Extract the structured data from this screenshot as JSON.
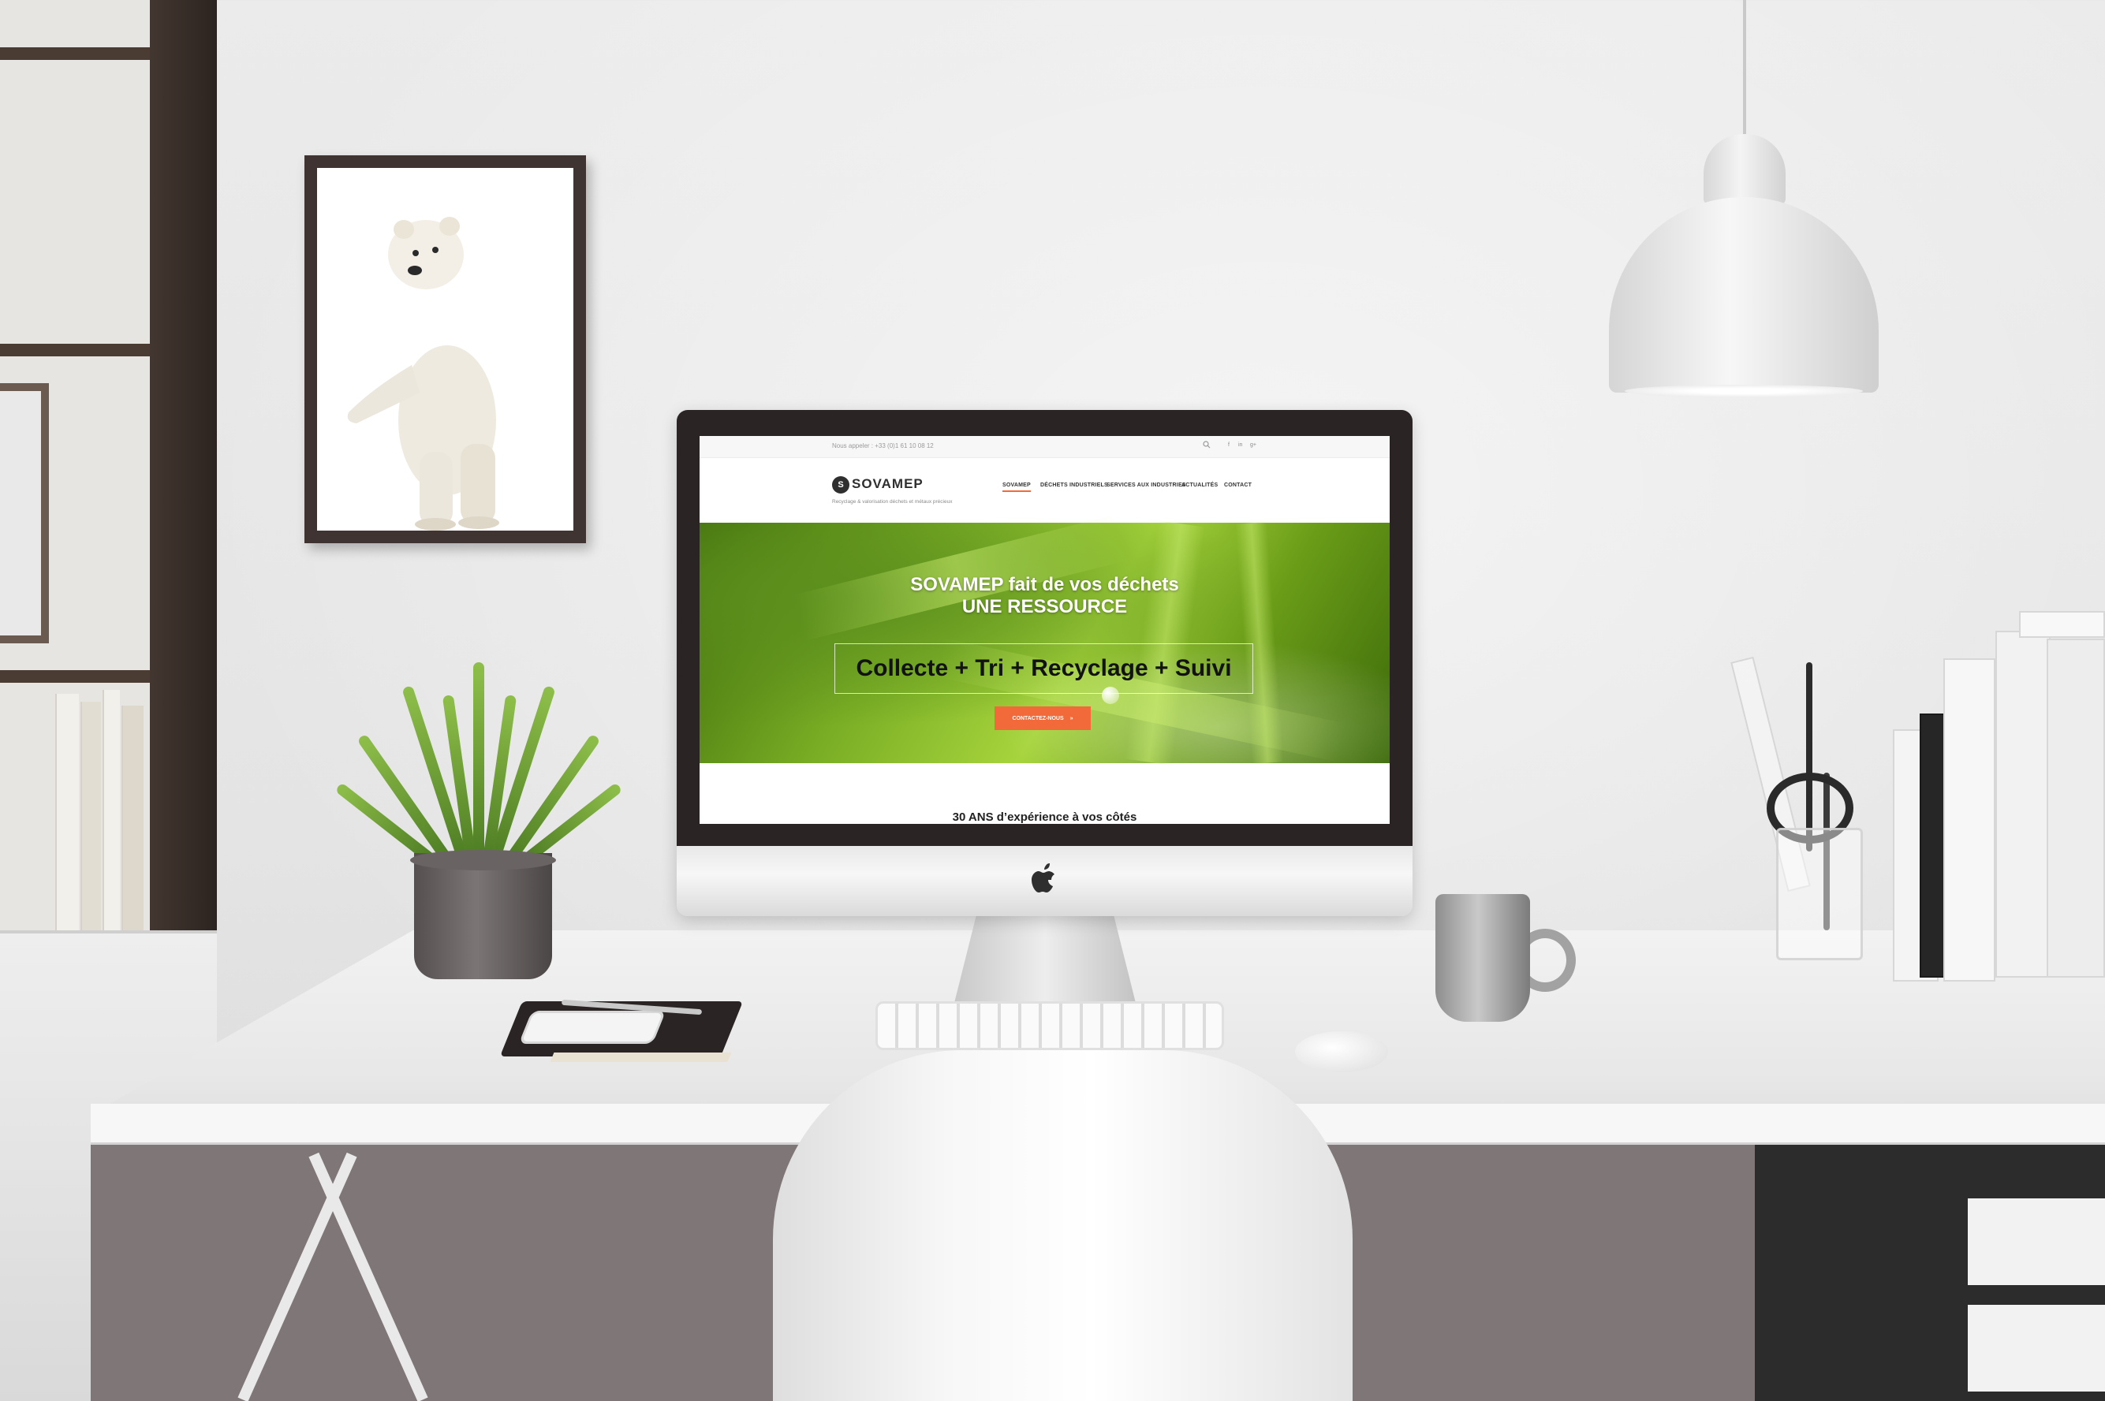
{
  "website": {
    "topbar": {
      "phone": "Nous appeler : +33 (0)1 61 10 08 12",
      "social_icons": [
        "facebook-icon",
        "linkedin-icon",
        "googleplus-icon"
      ]
    },
    "logo": {
      "mark": "S",
      "name": "SOVAMEP"
    },
    "tagline": "Recyclage & valorisation déchets et métaux précieux",
    "nav": [
      {
        "label": "SOVAMEP",
        "active": true
      },
      {
        "label": "DÉCHETS INDUSTRIELS"
      },
      {
        "label": "SERVICES AUX INDUSTRIES"
      },
      {
        "label": "ACTUALITÉS"
      },
      {
        "label": "CONTACT"
      }
    ],
    "hero": {
      "title_line1": "SOVAMEP fait de vos déchets",
      "title_line2": "UNE RESSOURCE",
      "subtitle": "Collecte + Tri + Recyclage + Suivi",
      "cta_label": "CONTACTEZ-NOUS",
      "cta_arrow": "»"
    },
    "section_title": "30 ANS d’expérience à vos côtés"
  },
  "device": {
    "logo": ""
  },
  "colors": {
    "accent": "#f26a3a",
    "hero_green": "#79ad24",
    "text_dark": "#2f2f2f"
  }
}
